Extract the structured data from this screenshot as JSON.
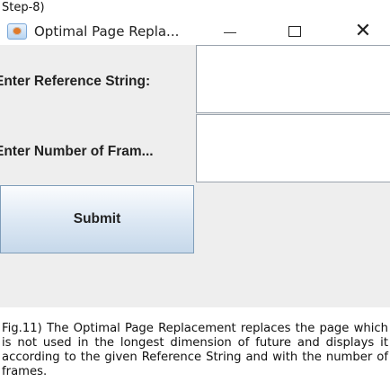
{
  "step_label": "Step-8)",
  "window": {
    "title": "Optimal Page Repla...",
    "controls": {
      "minimize": "—",
      "maximize": "☐",
      "close": "✕"
    }
  },
  "form": {
    "reference_label": "Enter Reference String:",
    "reference_value": "",
    "frames_label": "Enter Number of Fram...",
    "frames_value": "",
    "submit_label": "Submit"
  },
  "caption": "Fig.11) The Optimal Page Replacement replaces the page which is not used in the longest dimension of future and displays it according to the given Reference String and with the number of frames."
}
